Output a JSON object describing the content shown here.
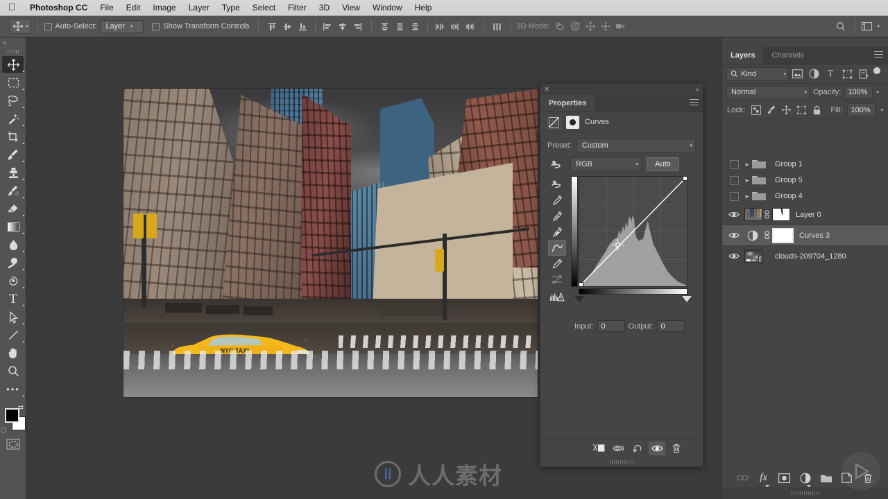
{
  "macmenu": {
    "apple_icon": "apple-logo-icon",
    "items": [
      "Photoshop CC",
      "File",
      "Edit",
      "Image",
      "Layer",
      "Type",
      "Select",
      "Filter",
      "3D",
      "View",
      "Window",
      "Help"
    ]
  },
  "options_bar": {
    "tool_icon": "move-tool-icon",
    "auto_select_label": "Auto-Select:",
    "auto_select_checked": false,
    "auto_select_value": "Layer",
    "show_transform_label": "Show Transform Controls",
    "show_transform_checked": false,
    "align_icons": [
      "align-top-edges-icon",
      "align-vertical-centers-icon",
      "align-bottom-edges-icon",
      "align-left-edges-icon",
      "align-horizontal-centers-icon",
      "align-right-edges-icon"
    ],
    "distribute_icons": [
      "distribute-top-edges-icon",
      "distribute-vertical-centers-icon",
      "distribute-bottom-edges-icon",
      "distribute-left-edges-icon",
      "distribute-horizontal-centers-icon",
      "distribute-right-edges-icon"
    ],
    "distribute_spacing_icon": "distribute-spacing-icon",
    "threed_mode_label": "3D Mode:",
    "threed_icons": [
      "rotate-3d-orbit-icon",
      "roll-3d-icon",
      "drag-3d-icon",
      "slide-3d-icon",
      "scale-3d-camera-icon"
    ],
    "search_icon": "search-icon",
    "workspace_icon": "workspace-switcher-icon",
    "workspace_chevron": "chevron-down-icon"
  },
  "tools": {
    "collapse_icon": "collapse-panel-icon",
    "items": [
      {
        "name": "move-tool",
        "icon": "move-tool-icon",
        "selected": true,
        "has_flyout": true
      },
      {
        "name": "rectangular-select-tool",
        "icon": "marquee-select-icon",
        "selected": false,
        "has_flyout": true
      },
      {
        "name": "lasso-tool",
        "icon": "lasso-icon",
        "selected": false,
        "has_flyout": true
      },
      {
        "name": "quick-selection-tool",
        "icon": "magic-wand-icon",
        "selected": false,
        "has_flyout": true
      },
      {
        "name": "crop-tool",
        "icon": "crop-icon",
        "selected": false,
        "has_flyout": true
      },
      {
        "name": "brush-tool",
        "icon": "brush-icon",
        "selected": false,
        "has_flyout": true
      },
      {
        "name": "clone-stamp-tool",
        "icon": "stamp-icon",
        "selected": false,
        "has_flyout": true
      },
      {
        "name": "history-brush-tool",
        "icon": "history-brush-icon",
        "selected": false,
        "has_flyout": true
      },
      {
        "name": "eraser-tool",
        "icon": "eraser-icon",
        "selected": false,
        "has_flyout": true
      },
      {
        "name": "gradient-tool",
        "icon": "gradient-icon",
        "selected": false,
        "has_flyout": true
      },
      {
        "name": "blur-tool",
        "icon": "blur-droplet-icon",
        "selected": false,
        "has_flyout": true
      },
      {
        "name": "dodge-tool",
        "icon": "dodge-icon",
        "selected": false,
        "has_flyout": true
      },
      {
        "name": "pen-tool",
        "icon": "pen-icon",
        "selected": false,
        "has_flyout": true
      },
      {
        "name": "type-tool",
        "icon": "text-type-icon",
        "selected": false,
        "has_flyout": true
      },
      {
        "name": "path-selection-tool",
        "icon": "path-arrow-icon",
        "selected": false,
        "has_flyout": true
      },
      {
        "name": "line-shape-tool",
        "icon": "line-shape-icon",
        "selected": false,
        "has_flyout": true
      },
      {
        "name": "hand-tool",
        "icon": "hand-icon",
        "selected": false,
        "has_flyout": false
      },
      {
        "name": "zoom-tool",
        "icon": "zoom-magnifier-icon",
        "selected": false,
        "has_flyout": false
      },
      {
        "name": "edit-toolbar",
        "icon": "ellipsis-icon",
        "selected": false,
        "has_flyout": true
      }
    ],
    "swap_icon": "swap-colors-icon",
    "default_colors_icon": "default-colors-icon",
    "foreground_color": "#000000",
    "background_color": "#ffffff",
    "quick_mask_icon": "quick-mask-icon"
  },
  "properties": {
    "close_icon": "close-icon",
    "collapse_icon": "collapse-double-chevron-icon",
    "tab_label": "Properties",
    "menu_icon": "panel-menu-icon",
    "adjustment_icon": "curves-adjustment-icon",
    "mask_icon": "layer-mask-thumbnail-icon",
    "adjustment_title": "Curves",
    "preset_label": "Preset:",
    "preset_value": "Custom",
    "channel_icon": "on-image-adjustment-icon",
    "channel_value": "RGB",
    "auto_button": "Auto",
    "curve_tools": [
      {
        "name": "target-adjustment-tool",
        "icon": "on-image-adjustment-icon",
        "selected": false
      },
      {
        "name": "black-point-eyedropper",
        "icon": "eyedropper-black-icon",
        "selected": false
      },
      {
        "name": "gray-point-eyedropper",
        "icon": "eyedropper-gray-icon",
        "selected": false
      },
      {
        "name": "white-point-eyedropper",
        "icon": "eyedropper-white-icon",
        "selected": false
      },
      {
        "name": "edit-points-curve-tool",
        "icon": "curve-points-icon",
        "selected": true
      },
      {
        "name": "draw-curve-pencil-tool",
        "icon": "pencil-icon",
        "selected": false
      },
      {
        "name": "smooth-curve-tool",
        "icon": "smooth-curve-icon",
        "selected": false
      },
      {
        "name": "clipping-warning-toggle",
        "icon": "histogram-warning-icon",
        "selected": false
      }
    ],
    "input_label": "Input:",
    "input_value": "0",
    "output_label": "Output:",
    "output_value": "0",
    "footer_buttons": [
      {
        "name": "clip-to-layer-button",
        "icon": "clip-to-layer-icon",
        "active": false
      },
      {
        "name": "view-previous-state-button",
        "icon": "eye-previous-state-icon",
        "active": false
      },
      {
        "name": "reset-adjustment-button",
        "icon": "reset-arrow-icon",
        "active": false
      },
      {
        "name": "toggle-layer-visibility-button",
        "icon": "eye-icon",
        "active": true
      },
      {
        "name": "delete-adjustment-layer-button",
        "icon": "trash-icon",
        "active": false
      }
    ]
  },
  "layers_panel": {
    "tabs": [
      {
        "label": "Layers",
        "active": true
      },
      {
        "label": "Channels",
        "active": false
      }
    ],
    "menu_icon": "panel-menu-icon",
    "filter": {
      "search_icon": "search-icon",
      "kind_value": "Kind",
      "chevron": "chevron-down-icon",
      "icons": [
        "filter-pixel-layers-icon",
        "filter-adjustment-layers-icon",
        "filter-type-layers-icon",
        "filter-shape-layers-icon",
        "filter-smart-objects-icon"
      ],
      "toggle_icon": "filter-enable-toggle-icon"
    },
    "blend_mode": "Normal",
    "opacity_label": "Opacity:",
    "opacity_value": "100%",
    "lock_label": "Lock:",
    "lock_icons": [
      "lock-transparent-pixels-icon",
      "lock-image-pixels-icon",
      "lock-position-icon",
      "lock-artboard-nesting-icon",
      "lock-all-icon"
    ],
    "fill_label": "Fill:",
    "fill_value": "100%",
    "rows": [
      {
        "name": "Group 1",
        "type": "group",
        "visible": false,
        "selected": false,
        "expander": "chevron-right-icon",
        "linked": false,
        "mask": false
      },
      {
        "name": "Group 5",
        "type": "group",
        "visible": false,
        "selected": false,
        "expander": "chevron-right-icon",
        "linked": false,
        "mask": false
      },
      {
        "name": "Group 4",
        "type": "group",
        "visible": false,
        "selected": false,
        "expander": "chevron-right-icon",
        "linked": false,
        "mask": false
      },
      {
        "name": "Layer 0",
        "type": "pixel",
        "visible": true,
        "selected": false,
        "linked": true,
        "mask": true
      },
      {
        "name": "Curves 3",
        "type": "adjustment",
        "visible": true,
        "selected": true,
        "linked": true,
        "mask": true
      },
      {
        "name": "clouds-209704_1280",
        "type": "smart",
        "visible": true,
        "selected": false,
        "linked": false,
        "mask": false
      }
    ],
    "footer_buttons": [
      {
        "name": "link-layers-button",
        "icon": "link-chain-icon",
        "label": "",
        "dim": true
      },
      {
        "name": "layer-style-button",
        "icon": "fx-icon",
        "label": "fx",
        "dim": false
      },
      {
        "name": "add-layer-mask-button",
        "icon": "layer-mask-icon",
        "label": "",
        "dim": false
      },
      {
        "name": "new-adjustment-layer-button",
        "icon": "half-circle-adjustment-icon",
        "label": "",
        "dim": false
      },
      {
        "name": "new-group-button",
        "icon": "folder-icon",
        "label": "",
        "dim": false
      },
      {
        "name": "new-layer-button",
        "icon": "new-layer-icon",
        "label": "",
        "dim": false
      },
      {
        "name": "delete-layer-button",
        "icon": "trash-icon",
        "label": "",
        "dim": false
      }
    ]
  },
  "document": {
    "image_description": "New York City street scene with yellow taxi, crosswalk, pedestrians and tall buildings under dark storm clouds"
  },
  "watermarks": {
    "center_logo": "rrsc-logo-icon",
    "center_text": "人人素材",
    "play_icon": "play-button-overlay-icon"
  },
  "colors": {
    "app_background": "#3b3b3b",
    "panel_background": "#454545",
    "options_bar": "#535353",
    "selected_layer": "#5a5a5a",
    "text": "#c8c8c8",
    "menubar": "#d4d4d4"
  }
}
